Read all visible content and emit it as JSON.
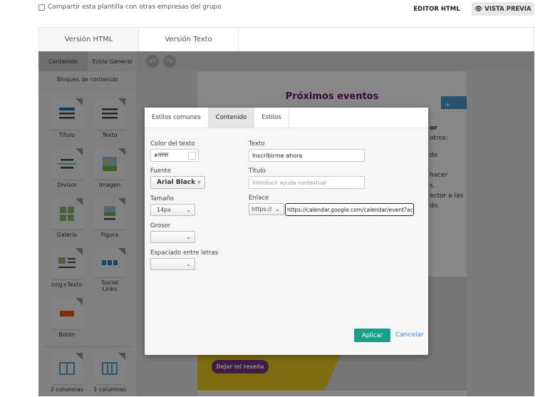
{
  "header": {
    "share_label": "Compartir esta plantilla con otras empresas del grupo",
    "share_checked": false,
    "editor_html": "EDITOR HTML",
    "preview": "VISTA PREVIA"
  },
  "version_tabs": [
    {
      "label": "Versión HTML",
      "active": true
    },
    {
      "label": "Versión Texto",
      "active": false
    }
  ],
  "sidebar": {
    "tabs": [
      {
        "label": "Contenido",
        "active": true
      },
      {
        "label": "Estilo General",
        "active": false
      }
    ],
    "section_title": "Bloques de contenido",
    "blocks": [
      {
        "label": "Título",
        "icon": "title-block-icon"
      },
      {
        "label": "Texto",
        "icon": "text-block-icon"
      },
      {
        "label": "Divisor",
        "icon": "divider-block-icon"
      },
      {
        "label": "Imagen",
        "icon": "image-block-icon"
      },
      {
        "label": "Galería",
        "icon": "gallery-block-icon"
      },
      {
        "label": "Figura",
        "icon": "figure-block-icon"
      },
      {
        "label": "Img+Texto",
        "icon": "image-text-block-icon"
      },
      {
        "label": "Social Links",
        "icon": "social-links-block-icon"
      },
      {
        "label": "Botón",
        "icon": "button-block-icon"
      }
    ],
    "columns": [
      {
        "label": "2 columnas"
      },
      {
        "label": "3 columnas"
      }
    ]
  },
  "email": {
    "heading": "Próximos eventos",
    "heading_color": "#6b1070",
    "review_button": "Dejar mi reseña",
    "partial_text": [
      "or",
      "otros:",
      "de",
      "hacer",
      "s.",
      "ector a las",
      "do."
    ]
  },
  "modal": {
    "tabs": [
      {
        "label": "Estilos comunes",
        "active": false
      },
      {
        "label": "Contenido",
        "active": true
      },
      {
        "label": "Estilos",
        "active": false
      }
    ],
    "color_label": "Color del texto",
    "color_value": "#ffffff",
    "font_label": "Fuente",
    "font_value": "Arial Black",
    "size_label": "Tamaño",
    "size_value": "14px",
    "weight_label": "Grosor",
    "weight_value": "",
    "spacing_label": "Espaciado entre letras",
    "spacing_value": "",
    "text_label": "Texto",
    "text_value": "Inscribirme ahora",
    "title_label": "Título",
    "title_placeholder": "Introducir ayuda contextual",
    "link_label": "Enlace",
    "protocol": "https://",
    "link_value": "https://calendar.google.com/calendar/event?action=T",
    "apply": "Aplicar",
    "cancel": "Cancelar",
    "apply_color": "#16a08a"
  }
}
